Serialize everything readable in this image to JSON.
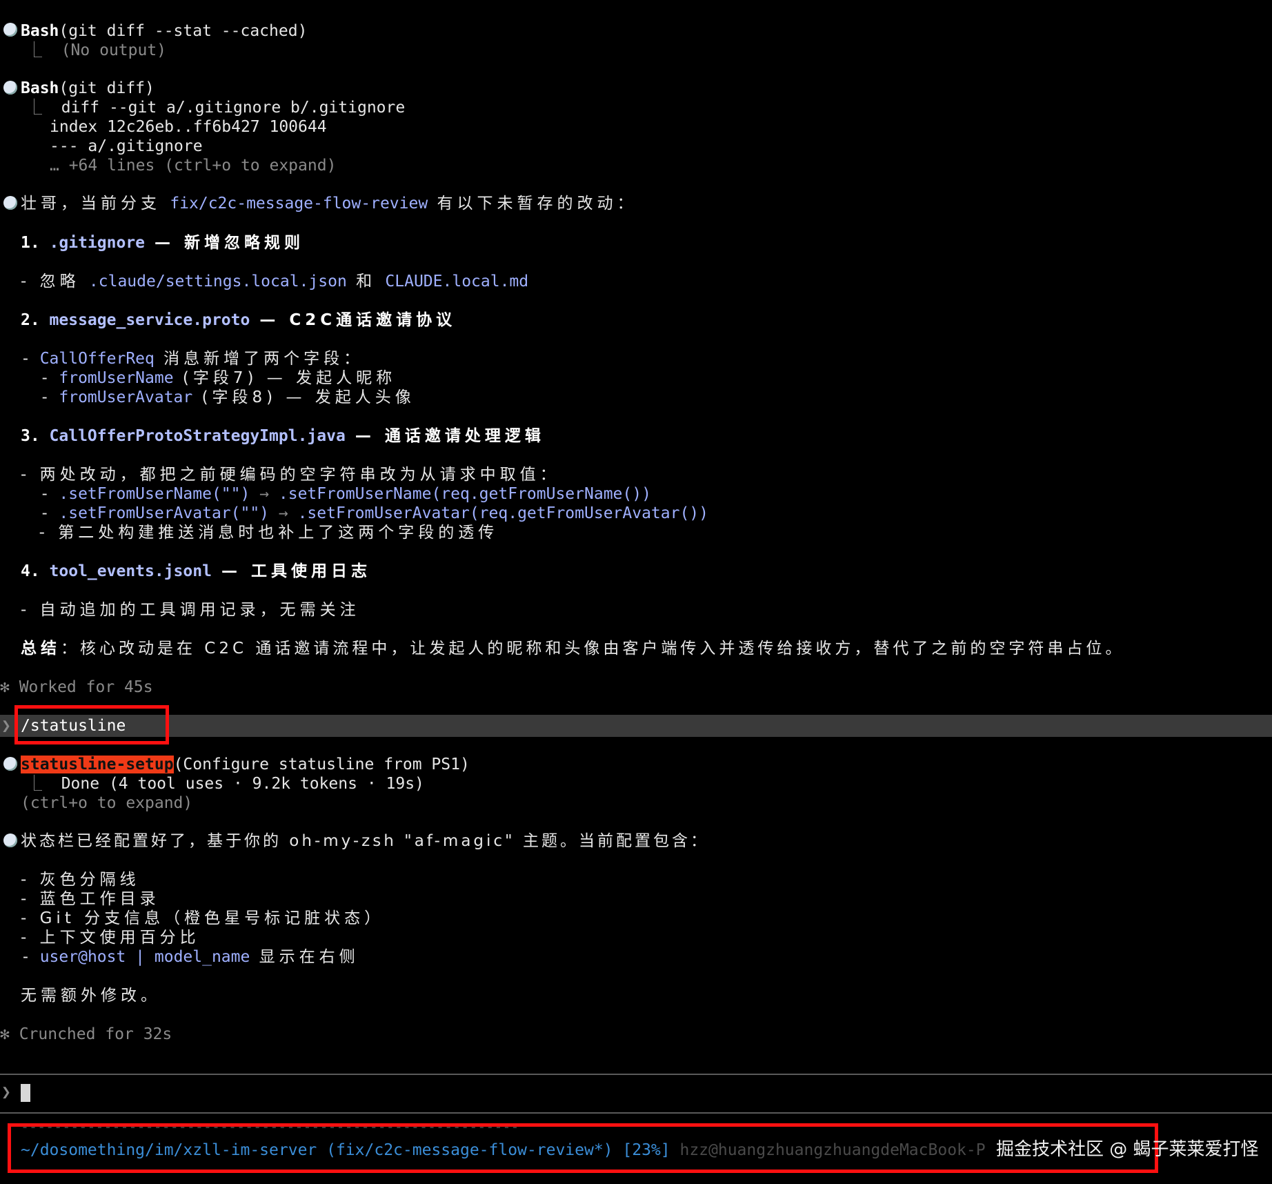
{
  "blocks": {
    "bash1": {
      "tool": "Bash",
      "args": "(git diff --stat --cached)",
      "result": "(No output)"
    },
    "bash2": {
      "tool": "Bash",
      "args": "(git diff)",
      "out1": "diff --git a/.gitignore b/.gitignore",
      "out2": "index 12c26eb..ff6b427 100644",
      "out3": "--- a/.gitignore",
      "more": "… +64 lines (ctrl+o to expand)"
    }
  },
  "summary": {
    "intro_pre": "壮哥，当前分支 ",
    "intro_branch": "fix/c2c-message-flow-review",
    "intro_post": " 有以下未暂存的改动：",
    "s1_num": "1. ",
    "s1_file": ".gitignore",
    "s1_title": " — 新增忽略规则",
    "s1_item_pre": "- 忽略 ",
    "s1_item_a": ".claude/settings.local.json",
    "s1_item_mid": " 和 ",
    "s1_item_b": "CLAUDE.local.md",
    "s2_num": "2. ",
    "s2_file": "message_service.proto",
    "s2_title": " — C2C通话邀请协议",
    "s2_item1_pre": "- ",
    "s2_item1_code": "CallOfferReq",
    "s2_item1_post": " 消息新增了两个字段：",
    "s2_item2_pre": "  - ",
    "s2_item2_code": "fromUserName",
    "s2_item2_post": " (字段7) — 发起人昵称",
    "s2_item3_pre": "  - ",
    "s2_item3_code": "fromUserAvatar",
    "s2_item3_post": " (字段8) — 发起人头像",
    "s3_num": "3. ",
    "s3_file": "CallOfferProtoStrategyImpl.java",
    "s3_title": " — 通话邀请处理逻辑",
    "s3_item1": "- 两处改动，都把之前硬编码的空字符串改为从请求中取值：",
    "s3_item2_pre": "  - ",
    "s3_item2_a": ".setFromUserName(\"\")",
    "s3_item2_arrow": " → ",
    "s3_item2_b": ".setFromUserName(req.getFromUserName())",
    "s3_item3_pre": "  - ",
    "s3_item3_a": ".setFromUserAvatar(\"\")",
    "s3_item3_arrow": " → ",
    "s3_item3_b": ".setFromUserAvatar(req.getFromUserAvatar())",
    "s3_item4": "  - 第二处构建推送消息时也补上了这两个字段的透传",
    "s4_num": "4. ",
    "s4_file": "tool_events.jsonl",
    "s4_title": " — 工具使用日志",
    "s4_item": "- 自动追加的工具调用记录，无需关注",
    "conclusion_label": "总结",
    "conclusion_text": "：核心改动是在 C2C 通话邀请流程中，让发起人的昵称和头像由客户端传入并透传给接收方，替代了之前的空字符串占位。",
    "worked": "✻ Worked for 45s"
  },
  "prompt_history": {
    "caret": "❯",
    "command": "/statusline"
  },
  "agent": {
    "name": "statusline-setup",
    "args": "(Configure statusline from PS1)",
    "result": "Done (4 tool uses · 9.2k tokens · 19s)",
    "expand": "(ctrl+o to expand)"
  },
  "status_msg": {
    "intro": "状态栏已经配置好了，基于你的 oh-my-zsh \"af-magic\" 主题。当前配置包含：",
    "i1": "- 灰色分隔线",
    "i2": "- 蓝色工作目录",
    "i3": "- Git 分支信息（橙色星号标记脏状态）",
    "i4": "- 上下文使用百分比",
    "i5_pre": "- ",
    "i5_code": "user@host | model_name",
    "i5_post": " 显示在右侧",
    "tail": "无需额外修改。",
    "crunched": "✻ Crunched for 32s"
  },
  "input": {
    "caret": "❯"
  },
  "statusline": {
    "separator": "------------------------------------------------------------",
    "path": "~/dosomething/im/xzll-im-server",
    "branch": " (fix/c2c-message-flow-review*)",
    "percent": " [23%]",
    "host": " hzz@huangzhuangzhuangdeMacBook-P"
  },
  "watermark": "掘金技术社区 @ 蝎子莱莱爱打怪"
}
